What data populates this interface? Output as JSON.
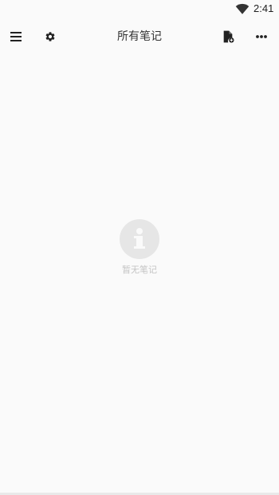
{
  "status_bar": {
    "time": "2:41",
    "icons": [
      "wifi-icon"
    ]
  },
  "toolbar": {
    "title": "所有笔记",
    "left_icons": [
      "menu-icon",
      "settings-icon"
    ],
    "right_icons": [
      "new-note-icon",
      "more-icon"
    ]
  },
  "empty_state": {
    "icon": "info-icon",
    "text": "暂无笔记"
  },
  "colors": {
    "background": "#fafafa",
    "icon": "#212121",
    "empty_circle": "#e6e6e6",
    "empty_text": "#c4c4c4"
  }
}
